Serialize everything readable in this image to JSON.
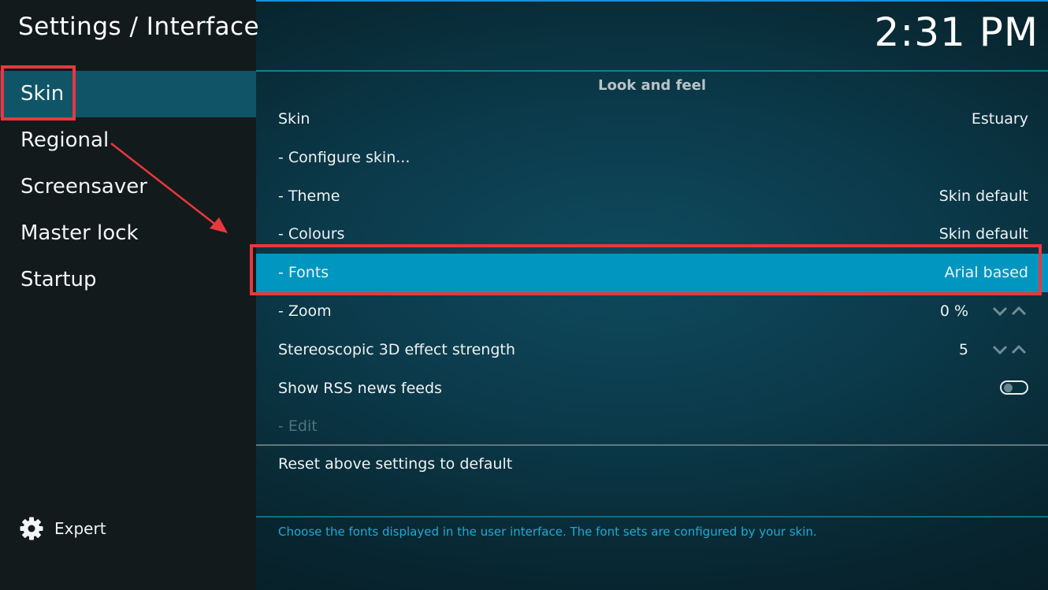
{
  "header": {
    "title": "Settings / Interface",
    "clock": "2:31 PM"
  },
  "sidebar": {
    "items": [
      {
        "label": "Skin",
        "active": true
      },
      {
        "label": "Regional"
      },
      {
        "label": "Screensaver"
      },
      {
        "label": "Master lock"
      },
      {
        "label": "Startup"
      }
    ],
    "expert_label": "Expert",
    "expert_icon": "gear-icon"
  },
  "main": {
    "section_title": "Look and feel",
    "rows": [
      {
        "label": "Skin",
        "value": "Estuary"
      },
      {
        "label": "- Configure skin...",
        "value": ""
      },
      {
        "label": "- Theme",
        "value": "Skin default"
      },
      {
        "label": "- Colours",
        "value": "Skin default"
      },
      {
        "label": "- Fonts",
        "value": "Arial based",
        "selected": true
      },
      {
        "label": "- Zoom",
        "value": "0 %",
        "control": "spinner"
      },
      {
        "label": "Stereoscopic 3D effect strength",
        "value": "5",
        "control": "spinner"
      },
      {
        "label": "Show RSS news feeds",
        "control": "toggle",
        "toggle_on": false
      },
      {
        "label": "- Edit",
        "disabled": true
      }
    ],
    "reset_label": "Reset above settings to default",
    "description": "Choose the fonts displayed in the user interface. The font sets are configured by your skin."
  },
  "colors": {
    "accent": "#0096bf",
    "sidebar_active": "#0f5567",
    "description_text": "#22a9d3",
    "annotation_red": "#e8383d"
  }
}
